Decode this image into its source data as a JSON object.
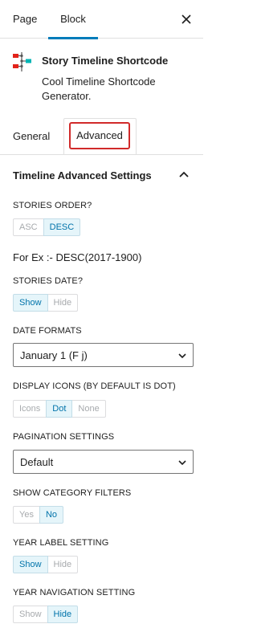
{
  "header": {
    "tabs": [
      "Page",
      "Block"
    ],
    "active_tab": "Block",
    "close_icon": "close-icon"
  },
  "block_card": {
    "icon": "timeline-block-icon",
    "title": "Story Timeline Shortcode",
    "description": "Cool Timeline Shortcode Generator."
  },
  "sub_tabs": {
    "general": "General",
    "advanced": "Advanced",
    "active": "Advanced"
  },
  "panel": {
    "title": "Timeline Advanced Settings",
    "toggle_icon": "chevron-up-icon",
    "stories_order": {
      "label": "STORIES ORDER?",
      "options": [
        "ASC",
        "DESC"
      ],
      "selected": "DESC",
      "note": "For Ex :- DESC(2017-1900)"
    },
    "stories_date": {
      "label": "STORIES DATE?",
      "options": [
        "Show",
        "Hide"
      ],
      "selected": "Show"
    },
    "date_formats": {
      "label": "DATE FORMATS",
      "value": "January 1 (F j)"
    },
    "display_icons": {
      "label": "DISPLAY ICONS (BY DEFAULT IS DOT)",
      "options": [
        "Icons",
        "Dot",
        "None"
      ],
      "selected": "Dot"
    },
    "pagination": {
      "label": "PAGINATION SETTINGS",
      "value": "Default"
    },
    "category_filters": {
      "label": "SHOW CATEGORY FILTERS",
      "options": [
        "Yes",
        "No"
      ],
      "selected": "No"
    },
    "year_label": {
      "label": "YEAR LABEL SETTING",
      "options": [
        "Show",
        "Hide"
      ],
      "selected": "Show"
    },
    "year_navigation": {
      "label": "YEAR NAVIGATION SETTING",
      "options": [
        "Show",
        "Hide"
      ],
      "selected": "Hide"
    }
  },
  "colors": {
    "accent": "#007cba",
    "highlight_border": "#d12a2a",
    "active_option_bg": "#e5f5fa",
    "active_option_text": "#0073aa",
    "icon_red": "#e2231a",
    "icon_teal": "#00b5b5"
  }
}
